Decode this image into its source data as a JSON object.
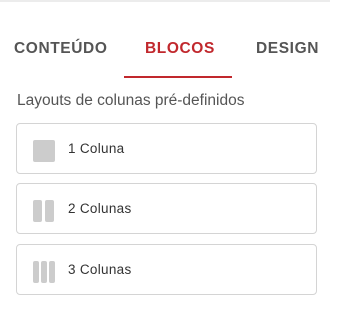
{
  "tabs": [
    {
      "label": "CONTEÚDO",
      "active": false
    },
    {
      "label": "BLOCOS",
      "active": true
    },
    {
      "label": "DESIGN",
      "active": false
    }
  ],
  "section": {
    "title": "Layouts de colunas pré-definidos"
  },
  "layouts": [
    {
      "label": "1 Coluna",
      "icon": "one-column-icon"
    },
    {
      "label": "2 Colunas",
      "icon": "two-columns-icon"
    },
    {
      "label": "3 Colunas",
      "icon": "three-columns-icon"
    }
  ],
  "colors": {
    "accent": "#c1282d",
    "tab_text": "#555555",
    "border": "#d4d4d4",
    "icon": "#cccccc"
  }
}
